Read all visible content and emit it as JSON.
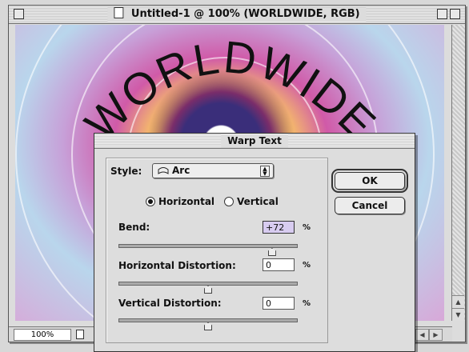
{
  "document": {
    "title": "Untitled-1 @ 100% (WORLDWIDE, RGB)",
    "zoom": "100%",
    "canvas_text": "WORLDWIDE"
  },
  "dialog": {
    "title": "Warp Text",
    "style_label": "Style:",
    "style_value": "Arc",
    "orientation": {
      "horizontal_label": "Horizontal",
      "vertical_label": "Vertical",
      "selected": "Horizontal"
    },
    "bend": {
      "label": "Bend:",
      "value": "+72",
      "unit": "%",
      "fraction": 0.86
    },
    "horizontal_distortion": {
      "label": "Horizontal Distortion:",
      "value": "0",
      "unit": "%",
      "fraction": 0.5
    },
    "vertical_distortion": {
      "label": "Vertical Distortion:",
      "value": "0",
      "unit": "%",
      "fraction": 0.5
    },
    "ok_label": "OK",
    "cancel_label": "Cancel"
  },
  "colors": {
    "dialog_bg": "#dddddd",
    "active_field": "#d8ccf0"
  }
}
